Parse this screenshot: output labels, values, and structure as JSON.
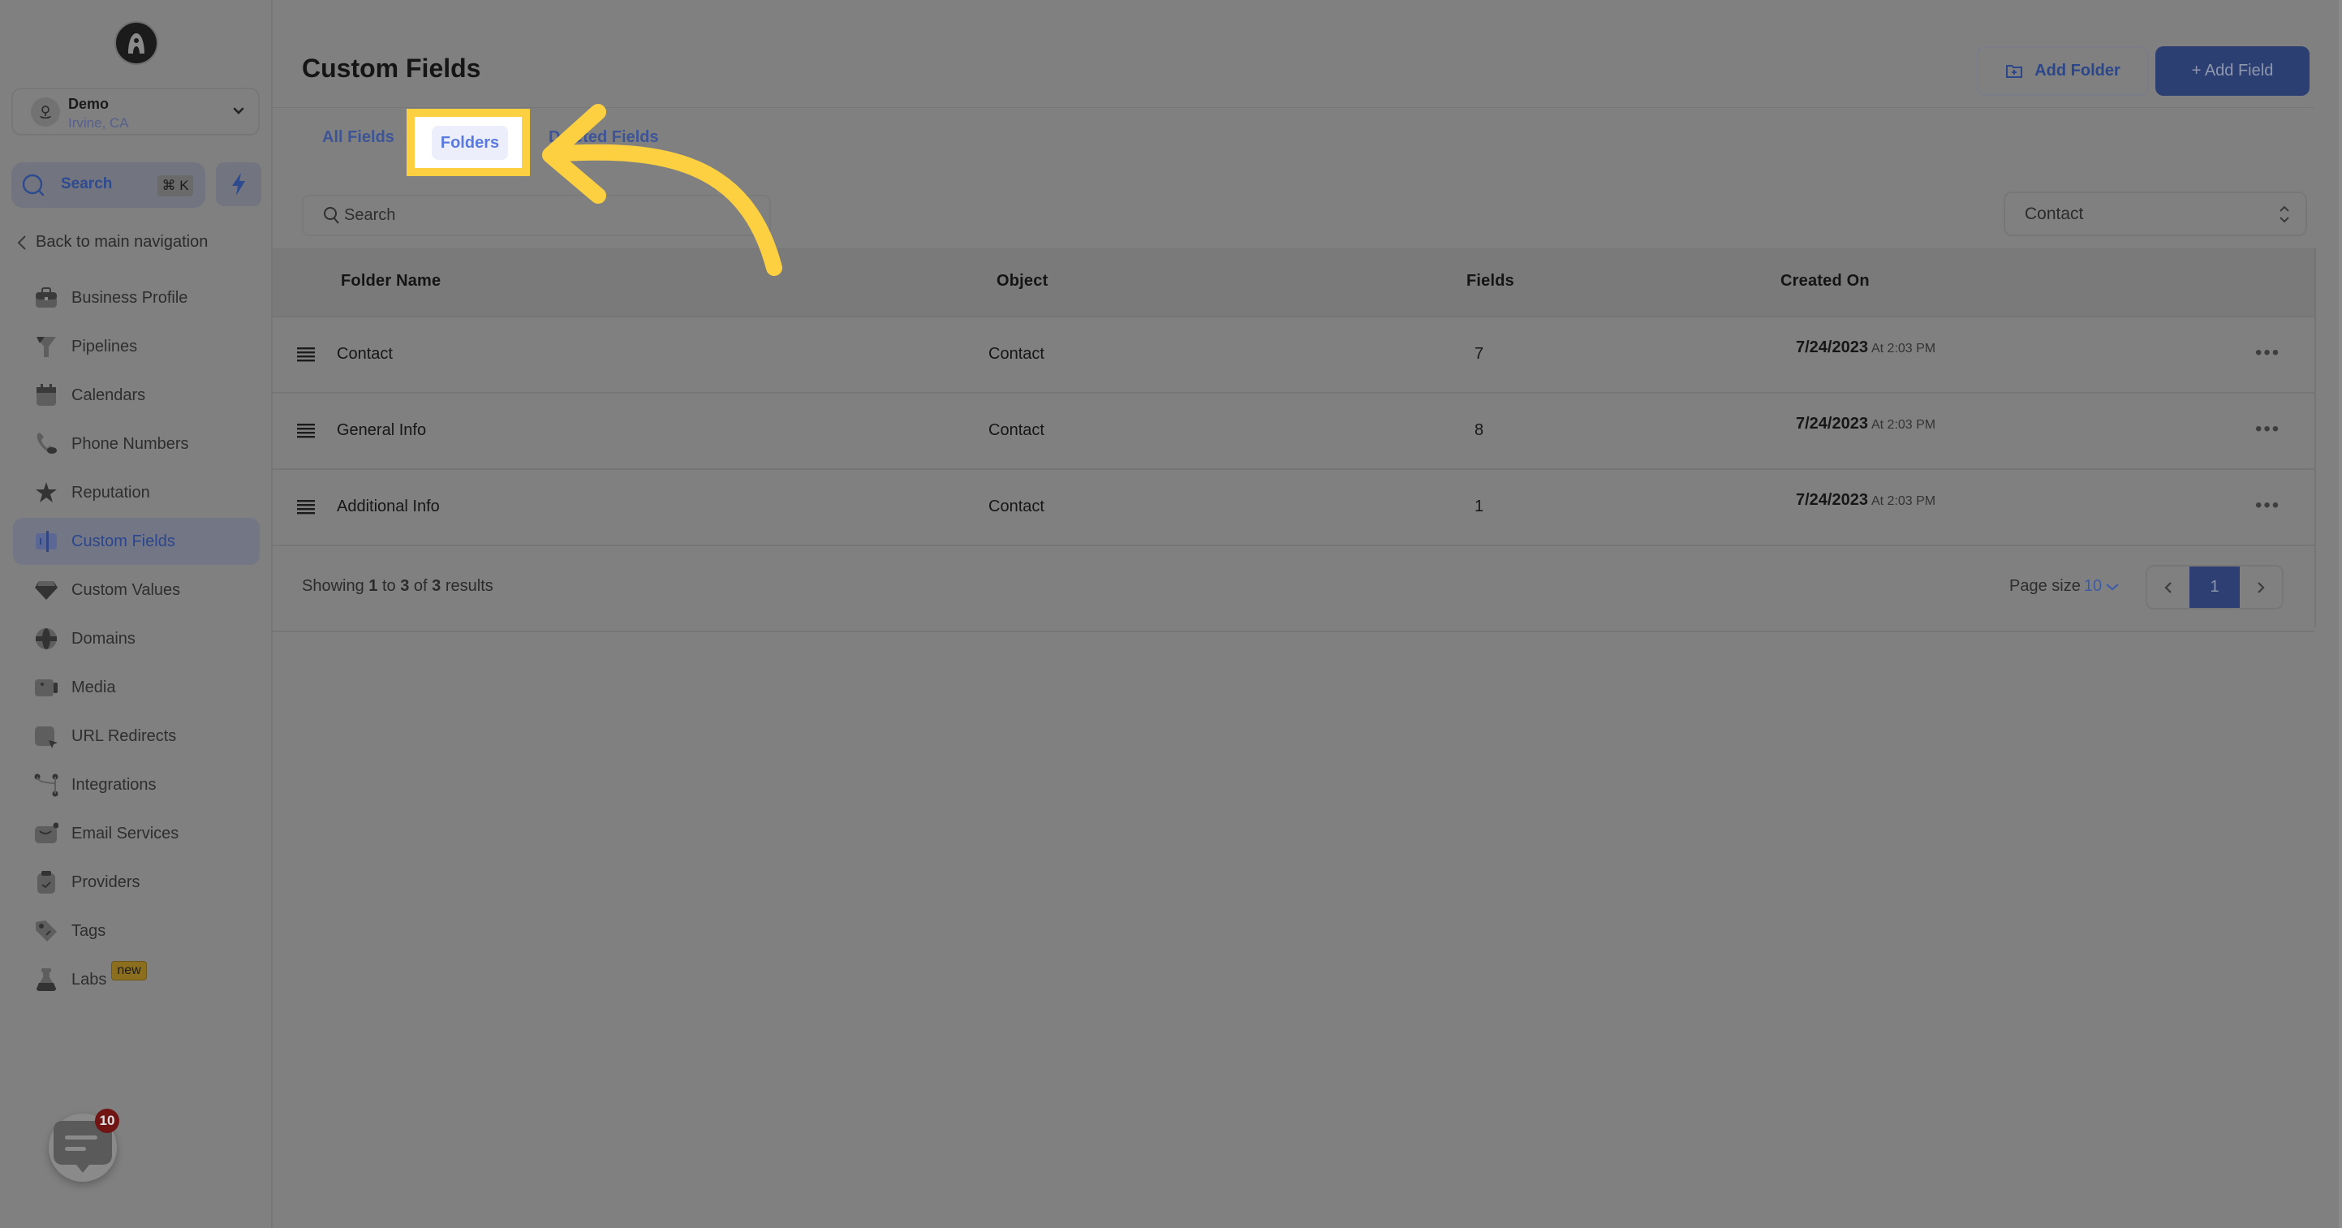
{
  "sidebar": {
    "location": {
      "name": "Demo",
      "city": "Irvine, CA"
    },
    "search": {
      "label": "Search",
      "shortcut": "⌘ K"
    },
    "back_label": "Back to main navigation",
    "items": [
      {
        "label": "Business Profile",
        "icon": "briefcase-icon"
      },
      {
        "label": "Pipelines",
        "icon": "funnel-icon"
      },
      {
        "label": "Calendars",
        "icon": "calendar-icon"
      },
      {
        "label": "Phone Numbers",
        "icon": "phone-icon"
      },
      {
        "label": "Reputation",
        "icon": "star-icon"
      },
      {
        "label": "Custom Fields",
        "icon": "custom-fields-icon",
        "active": true
      },
      {
        "label": "Custom Values",
        "icon": "gem-icon"
      },
      {
        "label": "Domains",
        "icon": "globe-icon"
      },
      {
        "label": "Media",
        "icon": "video-icon"
      },
      {
        "label": "URL Redirects",
        "icon": "redirect-icon"
      },
      {
        "label": "Integrations",
        "icon": "integrations-icon"
      },
      {
        "label": "Email Services",
        "icon": "mail-icon"
      },
      {
        "label": "Providers",
        "icon": "clipboard-check-icon"
      },
      {
        "label": "Tags",
        "icon": "tag-icon"
      },
      {
        "label": "Labs",
        "icon": "flask-icon",
        "badge": "new"
      }
    ],
    "chat": {
      "badge_count": "10"
    }
  },
  "header": {
    "title": "Custom Fields",
    "add_folder_label": "Add Folder",
    "add_field_label": "+ Add Field"
  },
  "tabs": [
    {
      "label": "All Fields"
    },
    {
      "label": "Folders",
      "active": true
    },
    {
      "label": "Deleted Fields"
    }
  ],
  "filters": {
    "search_placeholder": "Search",
    "object_select": "Contact"
  },
  "table": {
    "columns": [
      "Folder Name",
      "Object",
      "Fields",
      "Created On"
    ],
    "rows": [
      {
        "name": "Contact",
        "object": "Contact",
        "fields": "7",
        "date": "7/24/2023",
        "time": "At 2:03 PM"
      },
      {
        "name": "General Info",
        "object": "Contact",
        "fields": "8",
        "date": "7/24/2023",
        "time": "At 2:03 PM"
      },
      {
        "name": "Additional Info",
        "object": "Contact",
        "fields": "1",
        "date": "7/24/2023",
        "time": "At 2:03 PM"
      }
    ],
    "footer": {
      "showing_prefix": "Showing",
      "from": "1",
      "to_word": "to",
      "to": "3",
      "of_word": "of",
      "total": "3",
      "suffix": "results",
      "page_size_label": "Page size",
      "page_size": "10",
      "current_page": "1"
    }
  },
  "annotation": {
    "highlight_color": "#fcd041"
  }
}
